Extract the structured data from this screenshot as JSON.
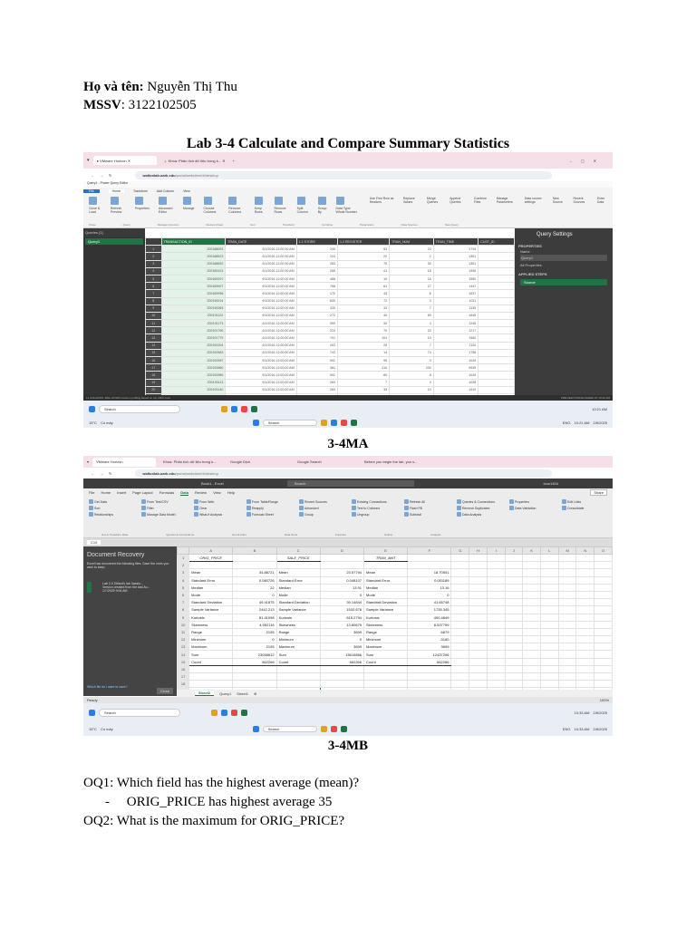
{
  "header": {
    "name_label": "Họ và tên:",
    "name_value": " Nguyễn Thị Thu",
    "id_label": "MSSV",
    "id_value": ": 3122102505"
  },
  "title": "Lab 3-4 Calculate and Compare Summary Statistics",
  "shot1": {
    "caption": "3-4MA",
    "browser_tabs": [
      "VMware Horizon",
      "Khóa: Phân tích dữ liệu trong k..."
    ],
    "url_host": "waltonlab.uark.edu",
    "url_path": "/portal/webclient/#/desktop",
    "window_title": "Query1 - Power Query Editor",
    "ribbon_tabs": [
      "File",
      "Home",
      "Transform",
      "Add Column",
      "View"
    ],
    "ribbon_groups": [
      "Close & Load",
      "Refresh Preview",
      "Properties",
      "Advanced Editor",
      "Manage",
      "Choose Columns",
      "Remove Columns",
      "Keep Rows",
      "Remove Rows",
      "Split Column",
      "Group By",
      "Data Type: Whole Number",
      "Use First Row as Headers",
      "Replace Values",
      "Merge Queries",
      "Append Queries",
      "Combine Files",
      "Manage Parameters",
      "Data source settings",
      "New Source",
      "Recent Sources",
      "Enter Data"
    ],
    "group_labels": [
      "Close",
      "Query",
      "Manage Columns",
      "Reduce Rows",
      "Sort",
      "Transform",
      "Combine",
      "Parameters",
      "Data Sources",
      "New Query"
    ],
    "queries_label": "Queries [1]",
    "query_item": "Query1",
    "formula": "= Sql.Database(\"essql1.walton.uark.edu\", \"WCOB_DILLards\", [Query=\"SELECT TRANSACT.*FROM TRANSACT WHERE TRAN_DATE BETWEEN '20160901'",
    "columns": [
      "TRANSACTION_ID",
      "TRAN_DATE",
      "1.2 STORE",
      "1.2 REGISTER",
      "TRAN_NUM",
      "TRAN_TIME",
      "CUST_ID"
    ],
    "rows": [
      [
        "200188093",
        "9/1/2016 12:00:00 AM",
        "240",
        "53",
        "23",
        "1744"
      ],
      [
        "200188523",
        "9/1/2016 12:00:00 AM",
        "244",
        "20",
        "2",
        "1351"
      ],
      [
        "200188692",
        "9/1/2016 12:00:00 AM",
        "283",
        "70",
        "30",
        "1351"
      ],
      [
        "200189124",
        "9/1/2016 12:00:00 AM",
        "268",
        "41",
        "16",
        "1956"
      ],
      [
        "200189297",
        "9/1/2016 12:00:00 AM",
        "488",
        "10",
        "16",
        "1550"
      ],
      [
        "200189907",
        "9/1/2016 12:00:00 AM",
        "768",
        "61",
        "27",
        "1447"
      ],
      [
        "200189998",
        "9/1/2016 12:00:00 AM",
        "170",
        "44",
        "6",
        "1637"
      ],
      [
        "200190014",
        "9/1/2016 12:00:00 AM",
        "830",
        "72",
        "3",
        "1011"
      ],
      [
        "200190063",
        "9/1/2016 12:00:00 AM",
        "330",
        "33",
        "7",
        "1135"
      ],
      [
        "200191122",
        "9/1/2016 12:00:00 AM",
        "272",
        "40",
        "69",
        "1645"
      ],
      [
        "200191173",
        "9/1/2016 12:00:00 AM",
        "399",
        "30",
        "4",
        "1246"
      ],
      [
        "200191790",
        "9/1/2016 12:00:00 AM",
        "224",
        "70",
        "20",
        "1217"
      ],
      [
        "200191779",
        "9/1/2016 12:00:00 AM",
        "701",
        "104",
        "10",
        "1550"
      ],
      [
        "200192204",
        "9/1/2016 12:00:00 AM",
        "263",
        "25",
        "7",
        "1120"
      ],
      [
        "200192583",
        "9/1/2016 12:00:00 AM",
        "743",
        "14",
        "74",
        "1758"
      ],
      [
        "200192557",
        "9/1/2016 12:00:00 AM",
        "902",
        "95",
        "3",
        "1044"
      ],
      [
        "200192860",
        "9/1/2016 12:00:00 AM",
        "381",
        "310",
        "330",
        "0935"
      ],
      [
        "200192989",
        "9/1/2016 12:00:00 AM",
        "902",
        "80",
        "8",
        "1044"
      ],
      [
        "200193113",
        "9/1/2016 12:00:00 AM",
        "283",
        "7",
        "2",
        "1028"
      ],
      [
        "200193140",
        "9/1/2016 12:00:00 AM",
        "283",
        "33",
        "10",
        "1910"
      ],
      [
        "200193327",
        "9/1/2016 12:00:00 AM",
        "193",
        "22",
        "20",
        "1720"
      ]
    ],
    "settings_title": "Query Settings",
    "properties_label": "PROPERTIES",
    "name_label": "Name",
    "name_value": "Query1",
    "all_properties": "All Properties",
    "applied_steps_label": "APPLIED STEPS",
    "step": "Source",
    "status_left": "11 COLUMNS, 999+ ROWS    Column profiling based on top 1000 rows",
    "status_right": "PREVIEW DOWNLOADED AT 10:20 AM",
    "taskbar_search": "Search",
    "weather_temp": "15°C",
    "weather_desc": "Có mây",
    "lang": "ENG",
    "time1": "10:21 AM",
    "date1": "2/8/2025",
    "time2": "10:21 AM",
    "date2": "2/8/2025"
  },
  "shot2": {
    "caption": "3-4MB",
    "browser_tabs": [
      "VMware Horizon",
      "Khóa: Phân tích dữ liệu trong k...",
      "Google Dịch",
      "Google Search",
      "Before you begin the lab, you s..."
    ],
    "url_host": "waltonlab.uark.edu",
    "url_path": "/portal/webclient/#/desktop",
    "window_title": "Book1 - Excel",
    "search": "Search",
    "user": "Icon1404",
    "share": "Share",
    "menu": [
      "File",
      "Home",
      "Insert",
      "Page Layout",
      "Formulas",
      "Data",
      "Review",
      "View",
      "Help"
    ],
    "ribbon_items": [
      "Get Data",
      "From Text/CSV",
      "From Web",
      "From Table/Range",
      "Recent Sources",
      "Existing Connections",
      "Refresh All",
      "Queries & Connections",
      "Properties",
      "Edit Links",
      "Sort",
      "Filter",
      "Clear",
      "Reapply",
      "Advanced",
      "Text to Columns",
      "Flash Fill",
      "Remove Duplicates",
      "Data Validation",
      "Consolidate",
      "Relationships",
      "Manage Data Model",
      "What-If Analysis",
      "Forecast Sheet",
      "Group",
      "Ungroup",
      "Subtotal",
      "Data Analysis"
    ],
    "group_labels": [
      "Get & Transform Data",
      "Queries & Connections",
      "Sort & Filter",
      "Data Tools",
      "Forecast",
      "Outline",
      "Analysis"
    ],
    "name_box": "C19",
    "recovery_title": "Document Recovery",
    "recovery_text": "Excel has recovered the following files. Save the ones you wish to keep.",
    "recovery_file": "Lab 2-0 Dillard's lab 3assio...",
    "recovery_file_sub": "Version created from the last Au...",
    "recovery_file_date": "1/7/2025 9:06 AM",
    "recovery_link": "Which file do I want to save?",
    "close": "Close",
    "col_letters": [
      "A",
      "B",
      "C",
      "D",
      "E",
      "F",
      "G",
      "H",
      "I",
      "J",
      "K",
      "L",
      "M",
      "N",
      "O"
    ],
    "headers": [
      "ORIG_PRICE",
      "SALE_PRICE",
      "TRAN_AMT"
    ],
    "stats": [
      [
        "Mean",
        "34.88721",
        "23.57794",
        "18.70501"
      ],
      [
        "Standard Error",
        "0.060726",
        "0.048107",
        "0.051189"
      ],
      [
        "Median",
        "22",
        "13.91",
        "13.16"
      ],
      [
        "Mode",
        "0",
        "0",
        "0"
      ],
      [
        "Standard Deviation",
        "49.41875",
        "39.14844",
        "41.65748"
      ],
      [
        "Sample Variance",
        "2442.213",
        "1532.678",
        "1735.345"
      ],
      [
        "Kurtosis",
        "81.41098",
        "615.2794",
        "490.4849"
      ],
      [
        "Skewness",
        "4.952116",
        "13.80675",
        "8.537759"
      ],
      [
        "Range",
        "2195",
        "3699",
        "6879"
      ],
      [
        "Minimum",
        "0",
        "0",
        "-3180"
      ],
      [
        "Maximum",
        "2195",
        "3699",
        "3699"
      ],
      [
        "Sum",
        "23058612",
        "15616866",
        "12437296"
      ],
      [
        "Count",
        "662266",
        "662266",
        "662266"
      ]
    ],
    "sheet_tabs": [
      "Sheet2",
      "Query1",
      "Sheet1"
    ],
    "status": "Ready",
    "zoom": "100%",
    "taskbar_search": "Search",
    "weather_temp": "15°C",
    "weather_desc": "Có mây",
    "lang": "ENG",
    "time1": "10:33 AM",
    "date1": "2/8/2025",
    "time2": "10:33 AM",
    "date2": "2/8/2025"
  },
  "questions": [
    {
      "q": "OQ1: Which field has the highest average (mean)?",
      "a": "ORIG_PRICE has highest average 35"
    },
    {
      "q": "OQ2: What is the maximum for ORIG_PRICE?"
    }
  ]
}
